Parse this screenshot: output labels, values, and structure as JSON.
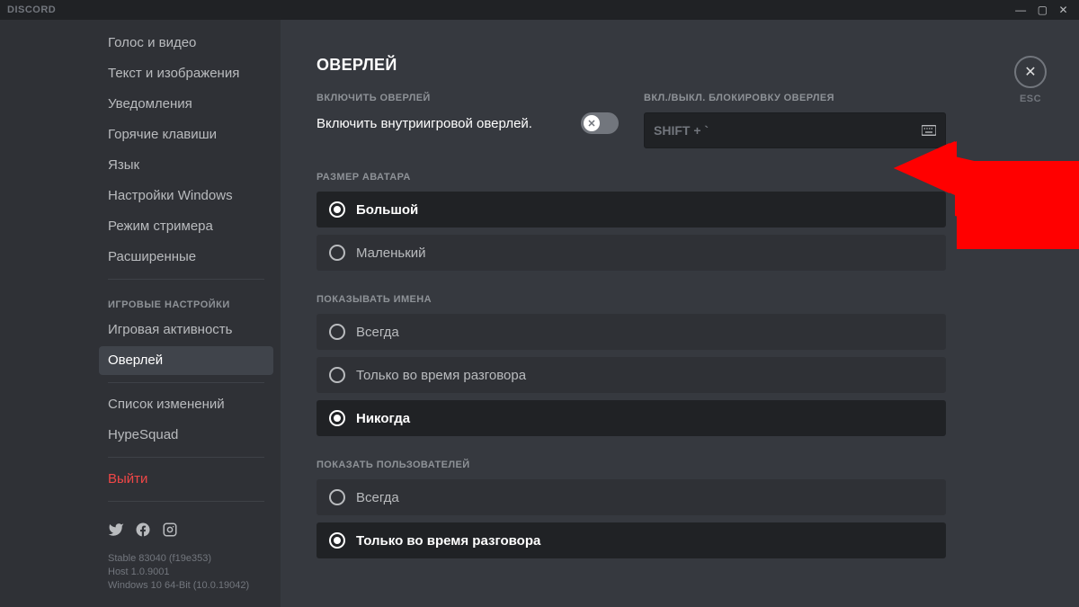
{
  "titlebar": {
    "app_name": "DISCORD"
  },
  "sidebar": {
    "items_top": [
      "Голос и видео",
      "Текст и изображения",
      "Уведомления",
      "Горячие клавиши",
      "Язык",
      "Настройки Windows",
      "Режим стримера",
      "Расширенные"
    ],
    "game_header": "ИГРОВЫЕ НАСТРОЙКИ",
    "items_game": [
      "Игровая активность",
      "Оверлей"
    ],
    "items_misc": [
      "Список изменений",
      "HypeSquad"
    ],
    "logout": "Выйти",
    "version": {
      "line1": "Stable 83040 (f19e353)",
      "line2": "Host 1.0.9001",
      "line3": "Windows 10 64-Bit (10.0.19042)"
    }
  },
  "content": {
    "title": "ОВЕРЛЕЙ",
    "enable_label": "ВКЛЮЧИТЬ ОВЕРЛЕЙ",
    "enable_text": "Включить внутриигровой оверлей.",
    "lock_label": "ВКЛ./ВЫКЛ. БЛОКИРОВКУ ОВЕРЛЕЯ",
    "lock_keybind": "SHIFT + `",
    "avatar_size": {
      "label": "РАЗМЕР АВАТАРА",
      "options": [
        "Большой",
        "Маленький"
      ],
      "selected": 0
    },
    "show_names": {
      "label": "ПОКАЗЫВАТЬ ИМЕНА",
      "options": [
        "Всегда",
        "Только во время разговора",
        "Никогда"
      ],
      "selected": 2
    },
    "show_users": {
      "label": "ПОКАЗАТЬ ПОЛЬЗОВАТЕЛЕЙ",
      "options": [
        "Всегда",
        "Только во время разговора"
      ],
      "selected": 1
    },
    "close_label": "ESC"
  }
}
